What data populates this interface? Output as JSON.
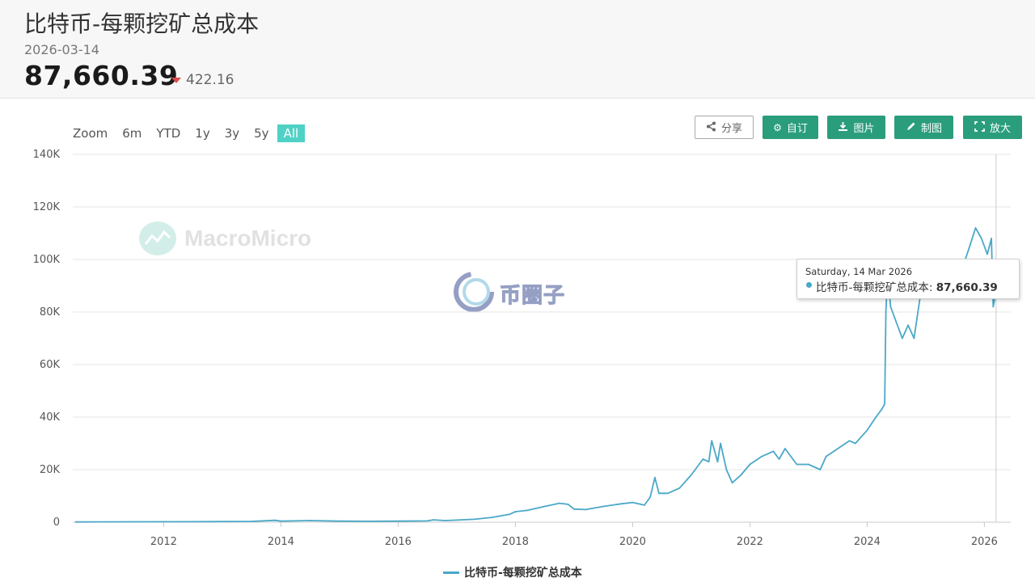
{
  "header": {
    "title": "比特币-每颗挖矿总成本",
    "date": "2026-03-14",
    "price": "87,660.39",
    "change": "422.16",
    "change_direction": "down",
    "down_color": "#e0494b"
  },
  "zoom": {
    "label": "Zoom",
    "options": [
      "6m",
      "YTD",
      "1y",
      "3y",
      "5y",
      "All"
    ],
    "active": "All",
    "active_color": "#4fd1c5"
  },
  "toolbar": {
    "share": "分享",
    "customize": "自订",
    "image": "图片",
    "draw": "制图",
    "fullscreen": "放大",
    "button_color": "#2a9d7c"
  },
  "watermarks": {
    "macromicro": "MacroMicro",
    "coincircle": "币圈子"
  },
  "tooltip": {
    "date": "Saturday, 14 Mar 2026",
    "series": "比特币-每颗挖矿总成本",
    "value": "87,660.39"
  },
  "legend": {
    "series": "比特币-每颗挖矿总成本",
    "color": "#4aa8c8"
  },
  "chart_data": {
    "type": "line",
    "series": [
      {
        "name": "比特币-每颗挖矿总成本",
        "color": "#4aa8c8",
        "points": [
          [
            2010.5,
            100
          ],
          [
            2011.5,
            150
          ],
          [
            2012.5,
            200
          ],
          [
            2013.5,
            300
          ],
          [
            2013.9,
            700
          ],
          [
            2014.0,
            400
          ],
          [
            2014.5,
            600
          ],
          [
            2015.0,
            400
          ],
          [
            2015.5,
            350
          ],
          [
            2016.0,
            400
          ],
          [
            2016.5,
            500
          ],
          [
            2016.6,
            900
          ],
          [
            2016.8,
            600
          ],
          [
            2017.0,
            800
          ],
          [
            2017.3,
            1100
          ],
          [
            2017.6,
            1800
          ],
          [
            2017.9,
            3000
          ],
          [
            2018.0,
            4000
          ],
          [
            2018.2,
            4500
          ],
          [
            2018.5,
            6000
          ],
          [
            2018.75,
            7200
          ],
          [
            2018.9,
            6800
          ],
          [
            2019.0,
            5000
          ],
          [
            2019.2,
            4800
          ],
          [
            2019.5,
            6000
          ],
          [
            2019.8,
            7000
          ],
          [
            2020.0,
            7500
          ],
          [
            2020.2,
            6500
          ],
          [
            2020.3,
            9500
          ],
          [
            2020.38,
            17000
          ],
          [
            2020.45,
            11000
          ],
          [
            2020.6,
            11000
          ],
          [
            2020.8,
            13000
          ],
          [
            2021.0,
            18000
          ],
          [
            2021.2,
            24000
          ],
          [
            2021.3,
            23000
          ],
          [
            2021.35,
            31000
          ],
          [
            2021.45,
            23000
          ],
          [
            2021.5,
            30000
          ],
          [
            2021.6,
            20000
          ],
          [
            2021.7,
            15000
          ],
          [
            2021.85,
            18000
          ],
          [
            2022.0,
            22000
          ],
          [
            2022.2,
            25000
          ],
          [
            2022.4,
            27000
          ],
          [
            2022.5,
            24000
          ],
          [
            2022.6,
            28000
          ],
          [
            2022.8,
            22000
          ],
          [
            2023.0,
            22000
          ],
          [
            2023.2,
            20000
          ],
          [
            2023.3,
            25000
          ],
          [
            2023.5,
            28000
          ],
          [
            2023.7,
            31000
          ],
          [
            2023.8,
            30000
          ],
          [
            2024.0,
            35000
          ],
          [
            2024.15,
            40000
          ],
          [
            2024.25,
            43000
          ],
          [
            2024.3,
            45000
          ],
          [
            2024.32,
            80000
          ],
          [
            2024.35,
            95000
          ],
          [
            2024.4,
            82000
          ],
          [
            2024.5,
            76000
          ],
          [
            2024.6,
            70000
          ],
          [
            2024.7,
            75000
          ],
          [
            2024.8,
            70000
          ],
          [
            2024.9,
            85000
          ],
          [
            2025.0,
            92000
          ],
          [
            2025.2,
            88000
          ],
          [
            2025.4,
            90000
          ],
          [
            2025.6,
            95000
          ],
          [
            2025.75,
            105000
          ],
          [
            2025.85,
            112000
          ],
          [
            2025.95,
            108000
          ],
          [
            2026.05,
            102000
          ],
          [
            2026.12,
            108000
          ],
          [
            2026.15,
            82000
          ],
          [
            2026.2,
            87660
          ]
        ]
      }
    ],
    "x_ticks": [
      2012,
      2014,
      2016,
      2018,
      2020,
      2022,
      2024,
      2026
    ],
    "y_ticks": [
      0,
      20000,
      40000,
      60000,
      80000,
      100000,
      120000,
      140000
    ],
    "y_tick_labels": [
      "0",
      "20K",
      "40K",
      "60K",
      "80K",
      "100K",
      "120K",
      "140K"
    ],
    "xlim": [
      2010.45,
      2026.45
    ],
    "ylim": [
      0,
      140000
    ],
    "grid": true,
    "legend_position": "bottom-center"
  }
}
